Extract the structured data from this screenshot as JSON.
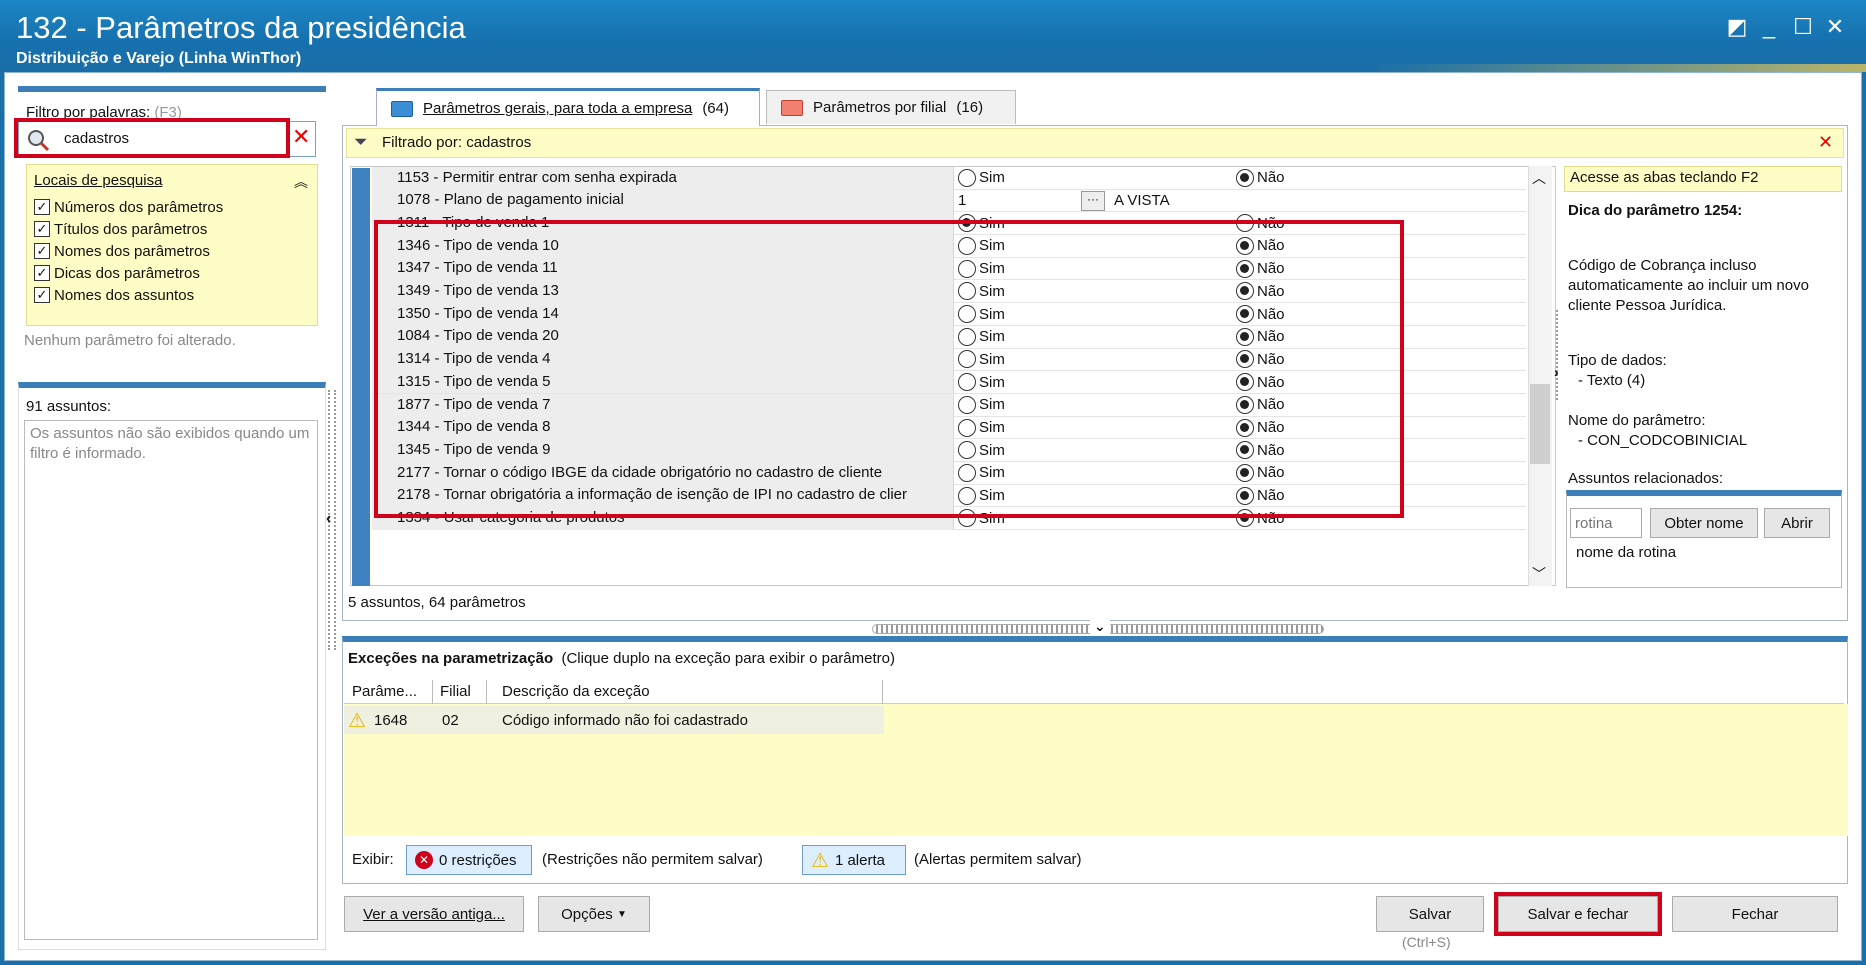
{
  "window": {
    "title": "132 - Parâmetros da presidência",
    "subtitle": "Distribuição e Varejo (Linha WinThor)"
  },
  "filter": {
    "label": "Filtro por palavras:",
    "shortcut": "(F3)",
    "value": "cadastros"
  },
  "locais": {
    "title": "Locais de pesquisa",
    "items": [
      {
        "label": "Números dos parâmetros",
        "checked": true
      },
      {
        "label": "Títulos dos parâmetros",
        "checked": true
      },
      {
        "label": "Nomes dos parâmetros",
        "checked": true
      },
      {
        "label": "Dicas dos parâmetros",
        "checked": true
      },
      {
        "label": "Nomes dos assuntos",
        "checked": true
      }
    ],
    "status": "Nenhum parâmetro foi alterado."
  },
  "assuntos": {
    "count_label": "91 assuntos:",
    "message": "Os assuntos não são exibidos quando um filtro é informado."
  },
  "tabs": [
    {
      "label": "Parâmetros gerais, para toda a empresa",
      "count": "(64)",
      "active": true
    },
    {
      "label": "Parâmetros por filial",
      "count": "(16)",
      "active": false
    }
  ],
  "filtrado": {
    "label": "Filtrado por: cadastros"
  },
  "grid": {
    "sim_label": "Sim",
    "nao_label": "Não",
    "rows": [
      {
        "name": "1153 - Permitir entrar com senha expirada",
        "selected": "nao"
      },
      {
        "name": "1078 - Plano de pagamento inicial",
        "value": "1",
        "extra": "A VISTA"
      },
      {
        "name": "1311 - Tipo de venda 1",
        "selected": "sim"
      },
      {
        "name": "1346 - Tipo de venda 10",
        "selected": "nao"
      },
      {
        "name": "1347 - Tipo de venda 11",
        "selected": "nao"
      },
      {
        "name": "1349 - Tipo de venda 13",
        "selected": "nao"
      },
      {
        "name": "1350 - Tipo de venda 14",
        "selected": "nao"
      },
      {
        "name": "1084 - Tipo de venda 20",
        "selected": "nao"
      },
      {
        "name": "1314 - Tipo de venda 4",
        "selected": "nao"
      },
      {
        "name": "1315 - Tipo de venda 5",
        "selected": "nao"
      },
      {
        "name": "1877 - Tipo de venda 7",
        "selected": "nao"
      },
      {
        "name": "1344 - Tipo de venda 8",
        "selected": "nao"
      },
      {
        "name": "1345 - Tipo de venda 9",
        "selected": "nao"
      },
      {
        "name": "2177 - Tornar o código IBGE da cidade obrigatório no cadastro de cliente",
        "selected": "nao"
      },
      {
        "name": "2178 - Tornar obrigatória a informação de isenção de IPI no cadastro de clier",
        "selected": "nao"
      },
      {
        "name": "1334 - Usar categoria de produtos",
        "selected": "nao"
      }
    ],
    "footer": "5 assuntos, 64 parâmetros"
  },
  "tips": {
    "bar": "Acesse as abas teclando F2",
    "title": "Dica do parâmetro 1254:",
    "description": "Código de Cobrança incluso automaticamente ao incluir um novo cliente Pessoa Jurídica.",
    "tipo_label": "Tipo de dados:",
    "tipo_value": "- Texto (4)",
    "nome_label": "Nome do parâmetro:",
    "nome_value": "- CON_CODCOBINICIAL",
    "assuntos_label": "Assuntos relacionados:",
    "rotina_placeholder": "rotina",
    "obter_nome": "Obter nome",
    "abrir": "Abrir",
    "rotina_hint": "nome da rotina"
  },
  "excecoes": {
    "title": "Exceções na parametrização",
    "subtitle": "(Clique duplo na exceção para exibir o parâmetro)",
    "columns": [
      "Parâme...",
      "Filial",
      "Descrição da exceção"
    ],
    "rows": [
      {
        "param": "1648",
        "filial": "02",
        "descricao": "Código informado não foi cadastrado"
      }
    ],
    "exibir": "Exibir:",
    "restricoes": "0 restrições",
    "restricoes_note": "(Restrições não permitem salvar)",
    "alertas": "1 alerta",
    "alertas_note": "(Alertas permitem salvar)"
  },
  "footer": {
    "ver_versao": "Ver a versão antiga...",
    "opcoes": "Opções",
    "salvar": "Salvar",
    "salvar_shortcut": "(Ctrl+S)",
    "salvar_fechar": "Salvar e fechar",
    "fechar": "Fechar"
  },
  "colors": {
    "title_bar": "#1a7ab8",
    "accent": "#3c7fb8",
    "highlight": "#d0021b",
    "yellow_panel": "#fffdc6"
  }
}
